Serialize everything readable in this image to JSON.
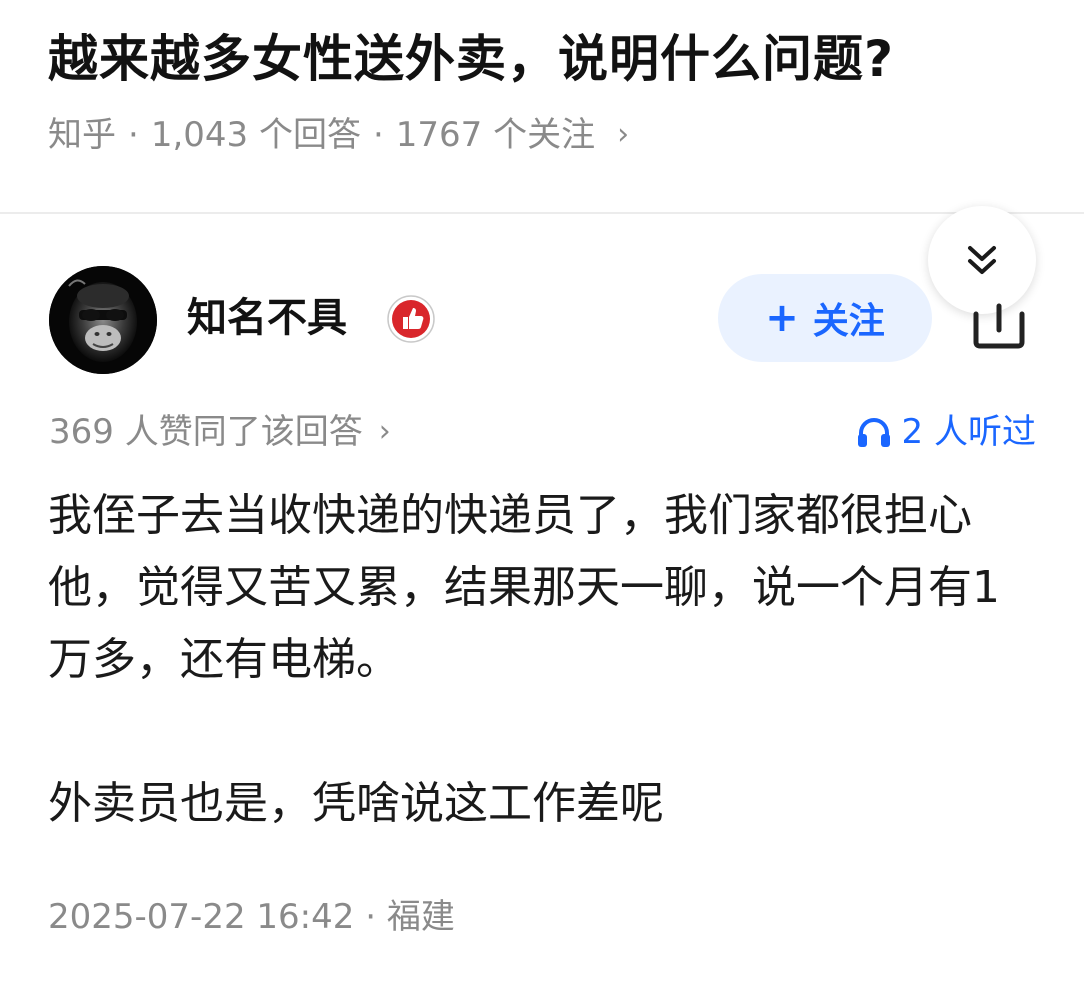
{
  "question": {
    "title": "越来越多女性送外卖，说明什么问题?",
    "source": "知乎",
    "answer_count": "1,043 个回答",
    "follower_count": "1767 个关注",
    "separator": "·",
    "chevron": "›"
  },
  "answer": {
    "author": {
      "name": "知名不具",
      "avatar_icon": "monkey-avatar",
      "badge_icon": "thumbs-up-badge-icon"
    },
    "follow_button": {
      "plus": "+",
      "label": "关注"
    },
    "share_icon": "share-icon",
    "collapse_icon": "double-chevron-down-icon",
    "votes": "369 人赞同了该回答",
    "votes_chevron": "›",
    "listened": "2 人听过",
    "content": [
      "我侄子去当收快递的快递员了，我们家都很担心他，觉得又苦又累，结果那天一聊，说一个月有1万多，还有电梯。",
      "外卖员也是，凭啥说这工作差呢"
    ],
    "footer": {
      "timestamp": "2025-07-22 16:42",
      "separator": "·",
      "location": "福建"
    }
  },
  "colors": {
    "accent": "#1a66ff",
    "follow_bg": "#eaf2ff",
    "meta_gray": "#8a8a8a",
    "badge_red": "#d9262b"
  }
}
